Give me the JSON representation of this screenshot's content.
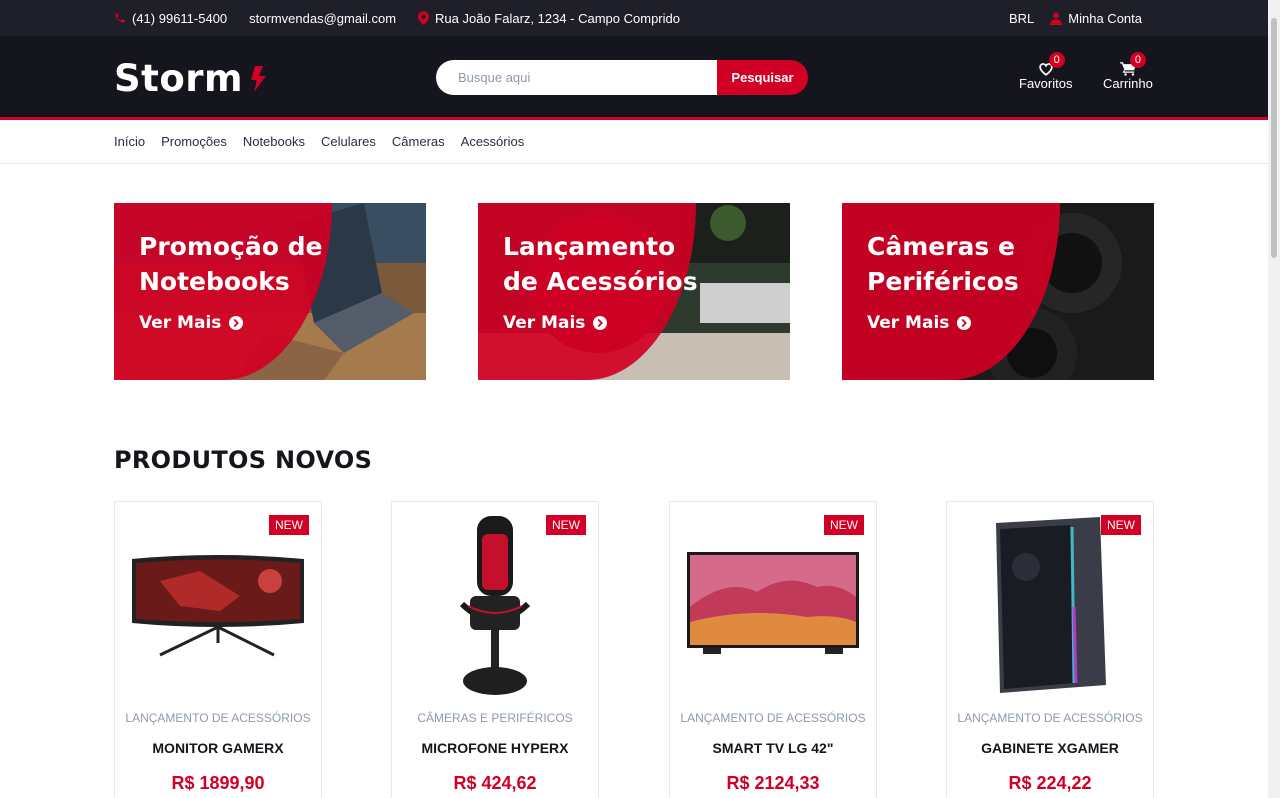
{
  "topbar": {
    "phone": "(41) 99611-5400",
    "email": "stormvendas@gmail.com",
    "address": "Rua João Falarz, 1234 - Campo Comprido",
    "currency": "BRL",
    "account": "Minha Conta"
  },
  "header": {
    "logo": "Storm",
    "search_placeholder": "Busque aqui",
    "search_button": "Pesquisar",
    "favorites_label": "Favoritos",
    "favorites_count": "0",
    "cart_label": "Carrinho",
    "cart_count": "0"
  },
  "nav": {
    "items": [
      "Início",
      "Promoções",
      "Notebooks",
      "Celulares",
      "Câmeras",
      "Acessórios"
    ]
  },
  "banners": [
    {
      "title": "Promoção de Notebooks",
      "cta": "Ver Mais"
    },
    {
      "title": "Lançamento de Acessórios",
      "cta": "Ver Mais"
    },
    {
      "title": "Câmeras e Periféricos",
      "cta": "Ver Mais"
    }
  ],
  "section": {
    "title": "PRODUTOS NOVOS"
  },
  "products": [
    {
      "badge": "NEW",
      "category": "LANÇAMENTO DE ACESSÓRIOS",
      "name": "MONITOR GAMERX",
      "price": "R$ 1899,90"
    },
    {
      "badge": "NEW",
      "category": "CÂMERAS E PERIFÉRICOS",
      "name": "MICROFONE HYPERX",
      "price": "R$ 424,62"
    },
    {
      "badge": "NEW",
      "category": "LANÇAMENTO DE ACESSÓRIOS",
      "name": "SMART TV LG 42\"",
      "price": "R$ 2124,33"
    },
    {
      "badge": "NEW",
      "category": "LANÇAMENTO DE ACESSÓRIOS",
      "name": "GABINETE XGAMER",
      "price": "R$ 224,22"
    }
  ],
  "colors": {
    "accent": "#d10024",
    "dark": "#15161d",
    "topbar": "#1e1f29"
  }
}
